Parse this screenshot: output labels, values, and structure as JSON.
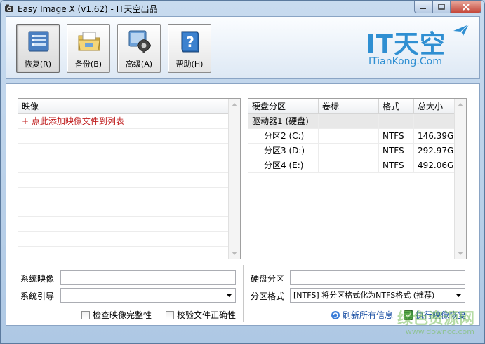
{
  "window": {
    "title": "Easy Image X (v1.62) - IT天空出品"
  },
  "toolbar": {
    "buttons": [
      {
        "label": "恢复(R)",
        "icon": "restore-icon"
      },
      {
        "label": "备份(B)",
        "icon": "backup-folder-icon"
      },
      {
        "label": "高级(A)",
        "icon": "advanced-settings-icon"
      },
      {
        "label": "帮助(H)",
        "icon": "help-book-icon"
      }
    ],
    "active_index": 0
  },
  "logo": {
    "main": "IT天空",
    "sub": "ITianKong.Com"
  },
  "image_list": {
    "columns": [
      "映像"
    ],
    "add_item": "+ 点此添加映像文件到列表"
  },
  "disk_table": {
    "columns": [
      "硬盘分区",
      "卷标",
      "格式",
      "总大小"
    ],
    "rows": [
      {
        "name": "驱动器1 (硬盘)",
        "label": "",
        "format": "",
        "size": ""
      },
      {
        "name": "分区2 (C:)",
        "label": "",
        "format": "NTFS",
        "size": "146.39G"
      },
      {
        "name": "分区3 (D:)",
        "label": "",
        "format": "NTFS",
        "size": "292.97G"
      },
      {
        "name": "分区4 (E:)",
        "label": "",
        "format": "NTFS",
        "size": "492.06G"
      }
    ]
  },
  "form": {
    "system_image_label": "系统映像",
    "system_image_value": "",
    "system_boot_label": "系统引导",
    "system_boot_value": "",
    "check_integrity": "检查映像完整性",
    "verify_files": "校验文件正确性",
    "disk_partition_label": "硬盘分区",
    "disk_partition_value": "",
    "partition_format_label": "分区格式",
    "partition_format_value": "[NTFS] 将分区格式化为NTFS格式 (推荐)",
    "refresh_link": "刷新所有信息",
    "execute_link": "执行映像恢复"
  },
  "watermark": {
    "main": "绿色资源网",
    "sub": "www.downcc.com"
  },
  "colors": {
    "brand_blue": "#2f8fd2",
    "add_item_red": "#c02020",
    "link_blue": "#1a4fa3"
  }
}
